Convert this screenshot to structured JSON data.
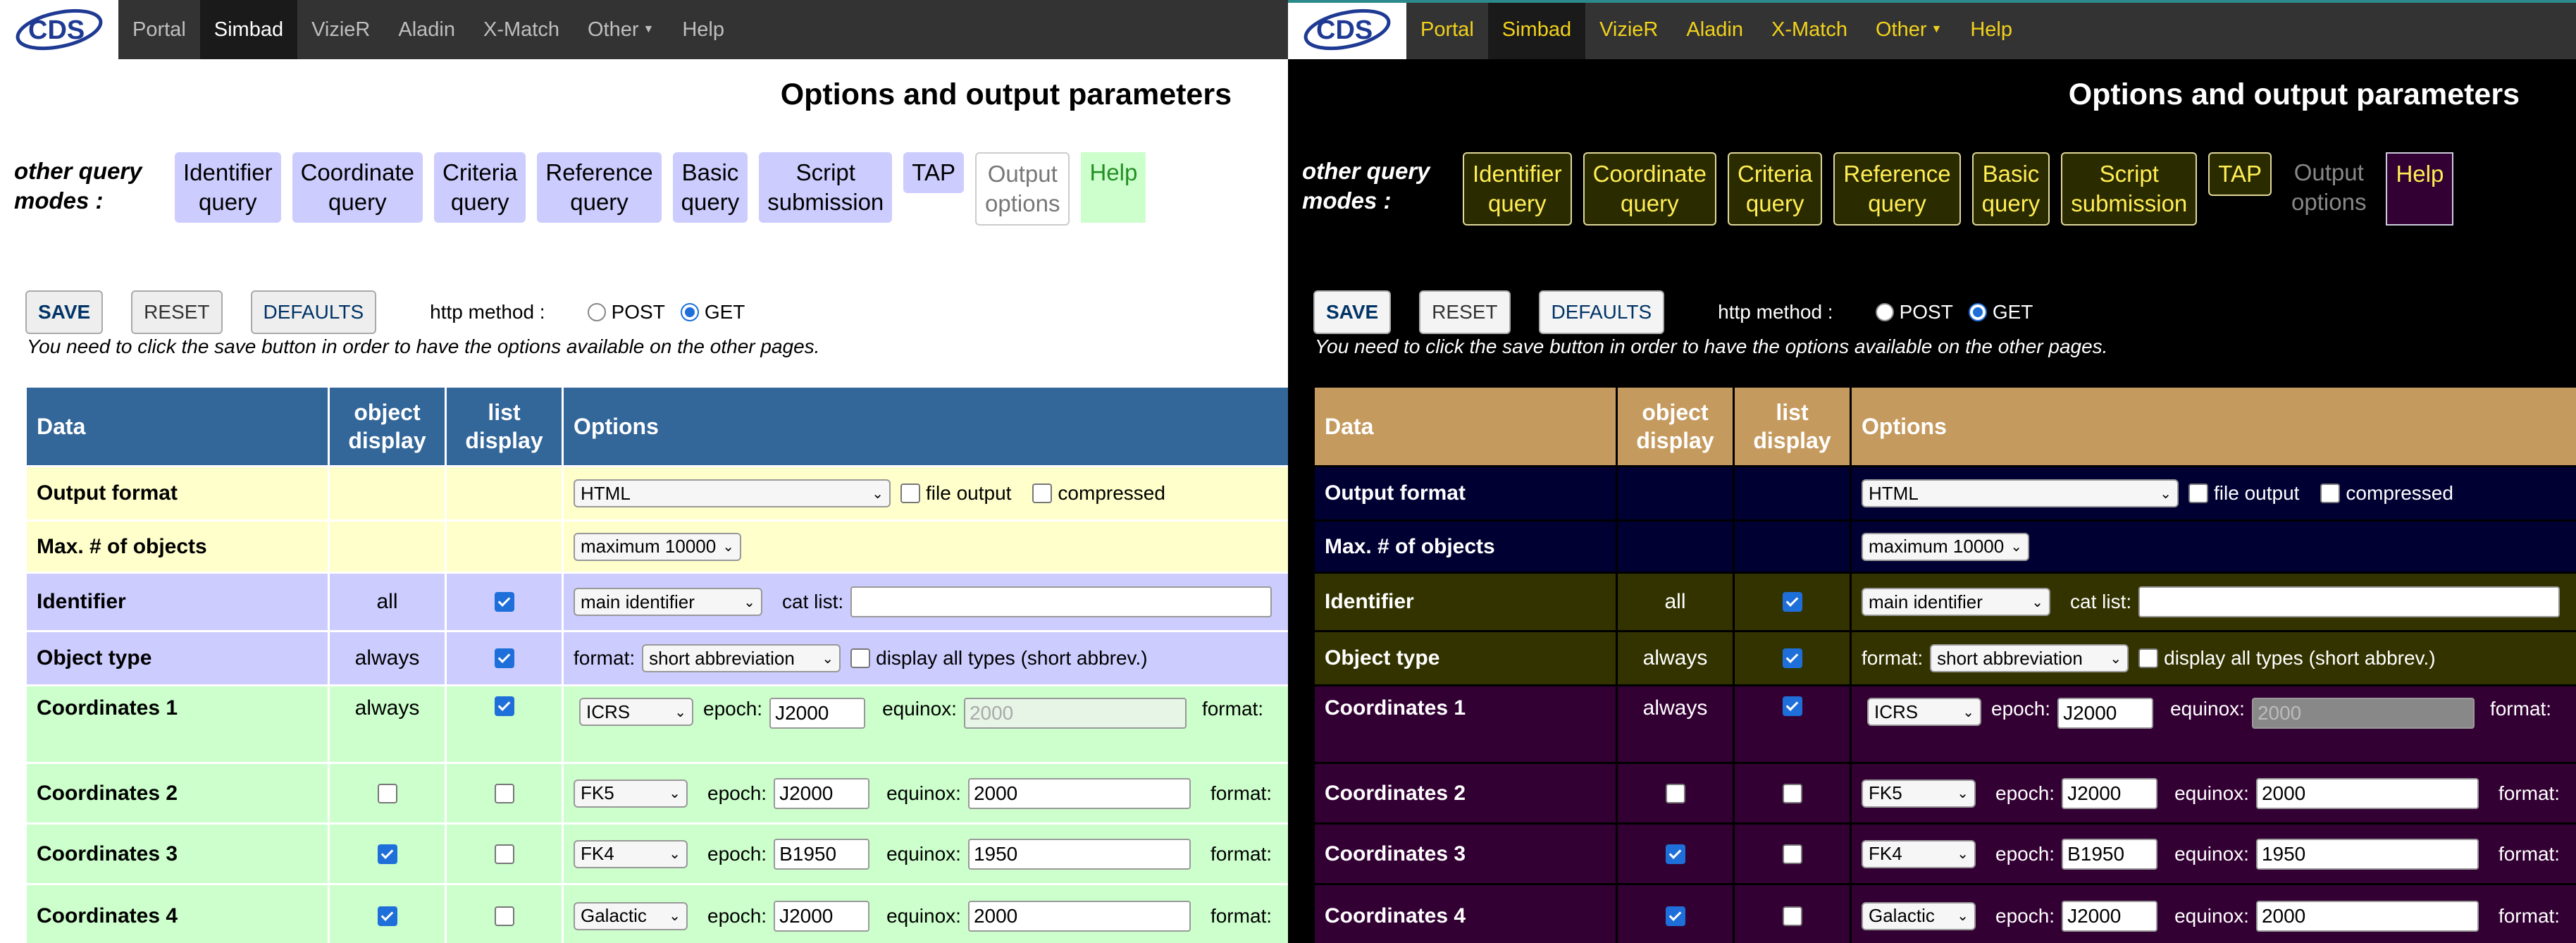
{
  "nav": {
    "logo_text": "CDS",
    "items": [
      {
        "label": "Portal"
      },
      {
        "label": "Simbad"
      },
      {
        "label": "VizieR"
      },
      {
        "label": "Aladin"
      },
      {
        "label": "X-Match"
      },
      {
        "label": "Other"
      },
      {
        "label": "Help"
      }
    ],
    "active": "Simbad"
  },
  "page_title": "Options and output parameters",
  "modes": {
    "label_line1": "other query",
    "label_line2": "modes :",
    "tabs": [
      {
        "line1": "Identifier",
        "line2": "query"
      },
      {
        "line1": "Coordinate",
        "line2": "query"
      },
      {
        "line1": "Criteria",
        "line2": "query"
      },
      {
        "line1": "Reference",
        "line2": "query"
      },
      {
        "line1": "Basic",
        "line2": "query"
      },
      {
        "line1": "Script",
        "line2": "submission"
      },
      {
        "line1": "TAP",
        "line2": ""
      },
      {
        "line1": "Output",
        "line2": "options"
      },
      {
        "line1": "Help",
        "line2": ""
      }
    ]
  },
  "buttons": {
    "save": "SAVE",
    "reset": "RESET",
    "defaults": "DEFAULTS",
    "http_method_label": "http method :",
    "post": "POST",
    "get": "GET",
    "selected_method": "GET"
  },
  "note": "You need to click the save button in order to have the options available on the other pages.",
  "table": {
    "headers": {
      "data": "Data",
      "object_display_1": "object",
      "object_display_2": "display",
      "list_display_1": "list",
      "list_display_2": "display",
      "options": "Options"
    },
    "rows": {
      "output_format": {
        "label": "Output format",
        "format_value": "HTML",
        "file_output": "file output",
        "compressed": "compressed"
      },
      "max_objects": {
        "label": "Max. # of objects",
        "value": "maximum 10000"
      },
      "identifier": {
        "label": "Identifier",
        "object_display": "all",
        "list_checked": true,
        "select": "main identifier",
        "cat_list_label": "cat list:",
        "cat_list_value": ""
      },
      "object_type": {
        "label": "Object type",
        "object_display": "always",
        "list_checked": true,
        "format_label": "format:",
        "select": "short abbreviation",
        "display_all": "display all types (short abbrev.)"
      },
      "coordinates_1": {
        "label": "Coordinates 1",
        "object_display": "always",
        "list_checked": true,
        "frame": "ICRS",
        "epoch_label": "epoch:",
        "epoch": "J2000",
        "equinox_label": "equinox:",
        "equinox": "2000",
        "format_label": "format:"
      },
      "coordinates_2": {
        "label": "Coordinates 2",
        "object_checked": false,
        "list_checked": false,
        "frame": "FK5",
        "epoch_label": "epoch:",
        "epoch": "J2000",
        "equinox_label": "equinox:",
        "equinox": "2000",
        "format_label": "format:"
      },
      "coordinates_3": {
        "label": "Coordinates 3",
        "object_checked": true,
        "list_checked": false,
        "frame": "FK4",
        "epoch_label": "epoch:",
        "epoch": "B1950",
        "equinox_label": "equinox:",
        "equinox": "1950",
        "format_label": "format:"
      },
      "coordinates_4": {
        "label": "Coordinates 4",
        "object_checked": true,
        "list_checked": false,
        "frame": "Galactic",
        "epoch_label": "epoch:",
        "epoch": "J2000",
        "equinox_label": "equinox:",
        "equinox": "2000",
        "format_label": "format:"
      }
    }
  },
  "colors": {
    "light_header": "#336699",
    "light_yellow": "#ffffcc",
    "light_blue": "#ccccff",
    "light_green": "#ccffcc",
    "dark_header": "#c59a5f",
    "dark_nav_text": "#f2d21b",
    "checkbox_accent": "#1e6fd9"
  }
}
